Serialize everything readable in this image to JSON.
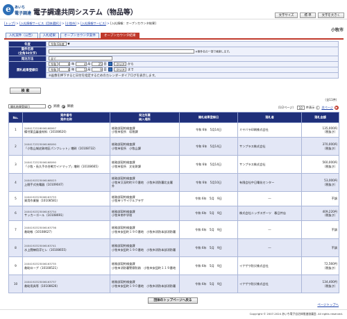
{
  "header": {
    "logo_mark": "e",
    "logo_line1": "あいち",
    "logo_line2": "電子調達",
    "title": "電子調達共同システム（物品等）",
    "buttons": [
      "文字サイズ",
      "標 準",
      "文字を大きく"
    ]
  },
  "breadcrumb": [
    "[トップ]",
    "[入札情報サービス（団体選択）]",
    "[小牧市]",
    "[入札情報サービス]",
    "[入札情報：オープンカウンタ結果]"
  ],
  "city": "小牧市",
  "tabs": [
    {
      "label": "入札案件（公告）",
      "active": false
    },
    {
      "label": "入札結果",
      "active": false
    },
    {
      "label": "オープンカウンタ案件",
      "active": false
    },
    {
      "label": "オープンカウンタ結果",
      "active": true
    }
  ],
  "form": {
    "year_label": "年度",
    "year_value": "令和 6年度",
    "name_label": "案件名称",
    "name_sub": "（全角50文字）",
    "name_note": "※案件名の一部で検索します。",
    "category_label": "発注方法",
    "category_value": "全て",
    "date_label": "開札結果登録日",
    "date_row1": [
      "令和",
      "6",
      "年",
      "4",
      "月",
      "25",
      "日",
      "クリア",
      "から"
    ],
    "date_row2": [
      "令和",
      "6",
      "年",
      "5",
      "月",
      "9",
      "日",
      "クリア",
      "まで"
    ],
    "date_note": "※画像を押下すると日付を指定するためのカレンダーダイアログを表示します。",
    "search_button": "検 索"
  },
  "sort": {
    "field": "開札結果登録日",
    "asc": "昇順",
    "desc": "降順",
    "selected": "desc"
  },
  "counts": {
    "total": "（全11件）",
    "per_page_value": "10",
    "per_page_suffix": "件表示",
    "page_info": "（1/2ページ）",
    "next": "次ページ"
  },
  "table": {
    "headers": [
      "No.",
      "案件番号\n案件名称",
      "発注所属\n納入場所",
      "開札結果登録日",
      "落札者",
      "落札金額"
    ],
    "rows": [
      {
        "no": "1",
        "id": "2404172318006168997",
        "name": "備付薬品審査材料（10108620）",
        "dept": "総務部契約検査課",
        "place": "小牧市役所　収税課",
        "date": "令和 6年　5月14日",
        "winner": "ミヤバラ印刷株式会社",
        "amount": "135,000円",
        "tax": "（税抜き）"
      },
      {
        "no": "2",
        "id": "2404172323006168090",
        "name": "「小牧山城史跡地区パンフレット」増刷（10108732）",
        "dept": "総務部契約検査課",
        "place": "小牧市役所　小牧山課",
        "date": "令和 6年　5月14日",
        "winner": "サンプラス株式会社",
        "amount": "370,000円",
        "tax": "（税抜き）"
      },
      {
        "no": "3",
        "id": "2404172323006168090",
        "name": "「小牧・長久手の合戦ガイドマップ」増刷（10108665）",
        "dept": "総務部契約検査課",
        "place": "小牧市役所　文化財課",
        "date": "令和 6年　5月14日",
        "winner": "サンプラス株式会社",
        "amount": "560,000円",
        "tax": "（税抜き）"
      },
      {
        "no": "4",
        "id": "2404192323006168023",
        "name": "上間手式充電器（10109047）",
        "dept": "総務部契約検査課",
        "place": "小牧市又深町町８０番地　小牧市消防署北支署　外",
        "date": "令和 6年　5月10日",
        "winner": "有限会社中日電化センター",
        "amount": "53,000円",
        "tax": "（税抜き）"
      },
      {
        "no": "5",
        "id": "2404192323006163733",
        "name": "資用作業服（10108581）",
        "dept": "総務部契約検査課",
        "place": "小牧市リサイクルプラザ",
        "date": "令和 6年　5月　9日",
        "winner": "―",
        "amount": "不調",
        "tax": ""
      },
      {
        "no": "6",
        "id": "2404192323006163734",
        "name": "サッカーゴール（10108691）",
        "dept": "総務部契約検査課",
        "place": "小牧市南中学校",
        "date": "令和 6年　5月　9日",
        "winner": "株式会社ニッポスポーツ　春日井店",
        "amount": "409,220円",
        "tax": "（税抜き）"
      },
      {
        "no": "7",
        "id": "2404192323006163736",
        "name": "救助帳（10108627）",
        "dept": "総務部契約検査課",
        "place": "小牧市安田町１９０番地　小牧市消防本部消防署",
        "date": "令和 6年　5月　9日",
        "winner": "―",
        "amount": "不調",
        "tax": ""
      },
      {
        "no": "8",
        "id": "2404192323006163741",
        "name": "水上闘練用浮ヒレ（10108655）",
        "dept": "総務部契約検査課",
        "place": "小牧市安田町１９０番地　小牧市消防本部消防署",
        "date": "令和 6年　5月　9日",
        "winner": "―",
        "amount": "不調",
        "tax": ""
      },
      {
        "no": "9",
        "id": "2404192323006163735",
        "name": "救助ロープ（10108521）",
        "dept": "総務部契約検査課",
        "place": "小牧市消防署警察防務　小牧市安田町１１９番地",
        "date": "令和 6年　5月　9日",
        "winner": "イナザワ防災株式会社",
        "amount": "72,560円",
        "tax": "（税抜き）"
      },
      {
        "no": "10",
        "id": "2404192323006163737",
        "name": "救助用具等（10108626）",
        "dept": "総務部契約検査課",
        "place": "小牧市安田町１９０番地　小牧市消防本部消防署",
        "date": "令和 6年　5月　9日",
        "winner": "イナザワ防災株式会社",
        "amount": "134,400円",
        "tax": "（税抜き）"
      }
    ]
  },
  "tool_button": "団体のトップページへ戻る",
  "page_top": "ページトップへ",
  "copyright": "Copyright © 2007-2024 あいち電子自治体推進協議会. All rights reserved."
}
